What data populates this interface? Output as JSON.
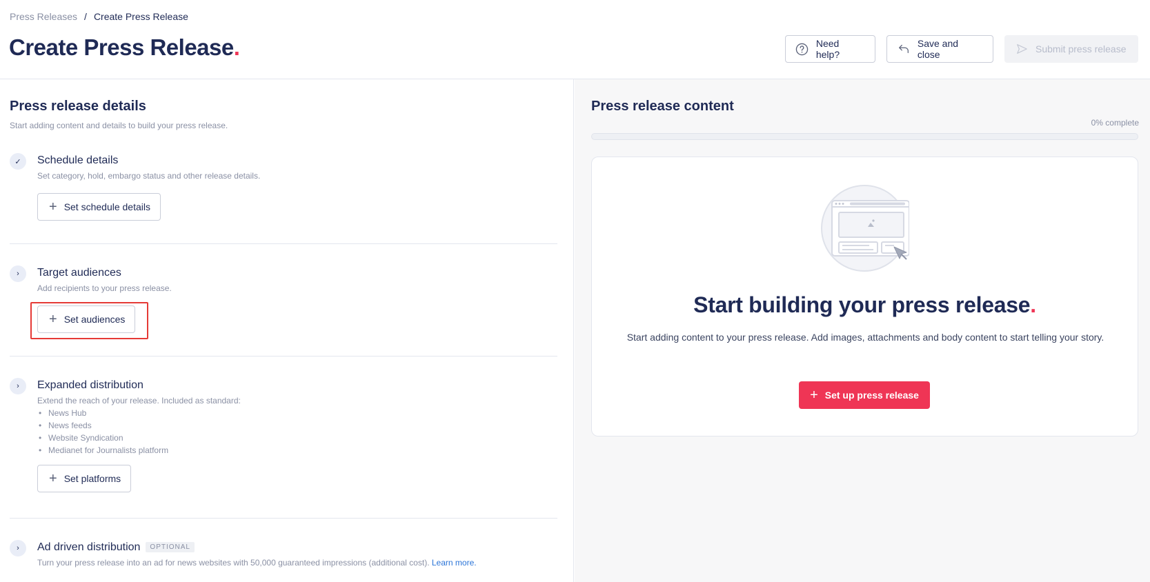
{
  "breadcrumb": {
    "parent": "Press Releases",
    "separator": "/",
    "current": "Create Press Release"
  },
  "header": {
    "title": "Create Press Release",
    "title_dot": ".",
    "help_label": "Need help?",
    "save_label": "Save and close",
    "submit_label": "Submit press release",
    "icons": {
      "help": "question-circle-icon",
      "save": "undo-arrow-icon",
      "submit": "send-icon"
    }
  },
  "details": {
    "title": "Press release details",
    "subtitle": "Start adding content and details to build your press release.",
    "steps": [
      {
        "title": "Schedule details",
        "subtitle": "Set category, hold, embargo status and other release details.",
        "button": "Set schedule details",
        "status_icon": "check-icon",
        "status_glyph": "✓"
      },
      {
        "title": "Target audiences",
        "subtitle": "Add recipients to your press release.",
        "button": "Set audiences",
        "status_icon": "chevron-right-icon",
        "status_glyph": "›"
      },
      {
        "title": "Expanded distribution",
        "subtitle": "Extend the reach of your release. Included as standard:",
        "list": [
          "News Hub",
          "News feeds",
          "Website Syndication",
          "Medianet for Journalists platform"
        ],
        "button": "Set platforms",
        "status_icon": "chevron-right-icon",
        "status_glyph": "›"
      },
      {
        "title": "Ad driven distribution",
        "badge": "OPTIONAL",
        "subtitle": "Turn your press release into an ad for news websites with 50,000 guaranteed impressions (additional cost).",
        "link": "Learn more.",
        "status_icon": "chevron-right-icon",
        "status_glyph": "›"
      }
    ]
  },
  "content": {
    "title": "Press release content",
    "progress_label": "0% complete",
    "progress_value": 0,
    "card_title": "Start building your press release",
    "card_title_dot": ".",
    "card_desc": "Start adding content to your press release. Add images, attachments and body content to start telling your story.",
    "primary_button": "Set up press release"
  },
  "colors": {
    "accent": "#ef3555",
    "navy": "#1f2a55",
    "muted": "#8a90a4",
    "link": "#2a74d8"
  }
}
